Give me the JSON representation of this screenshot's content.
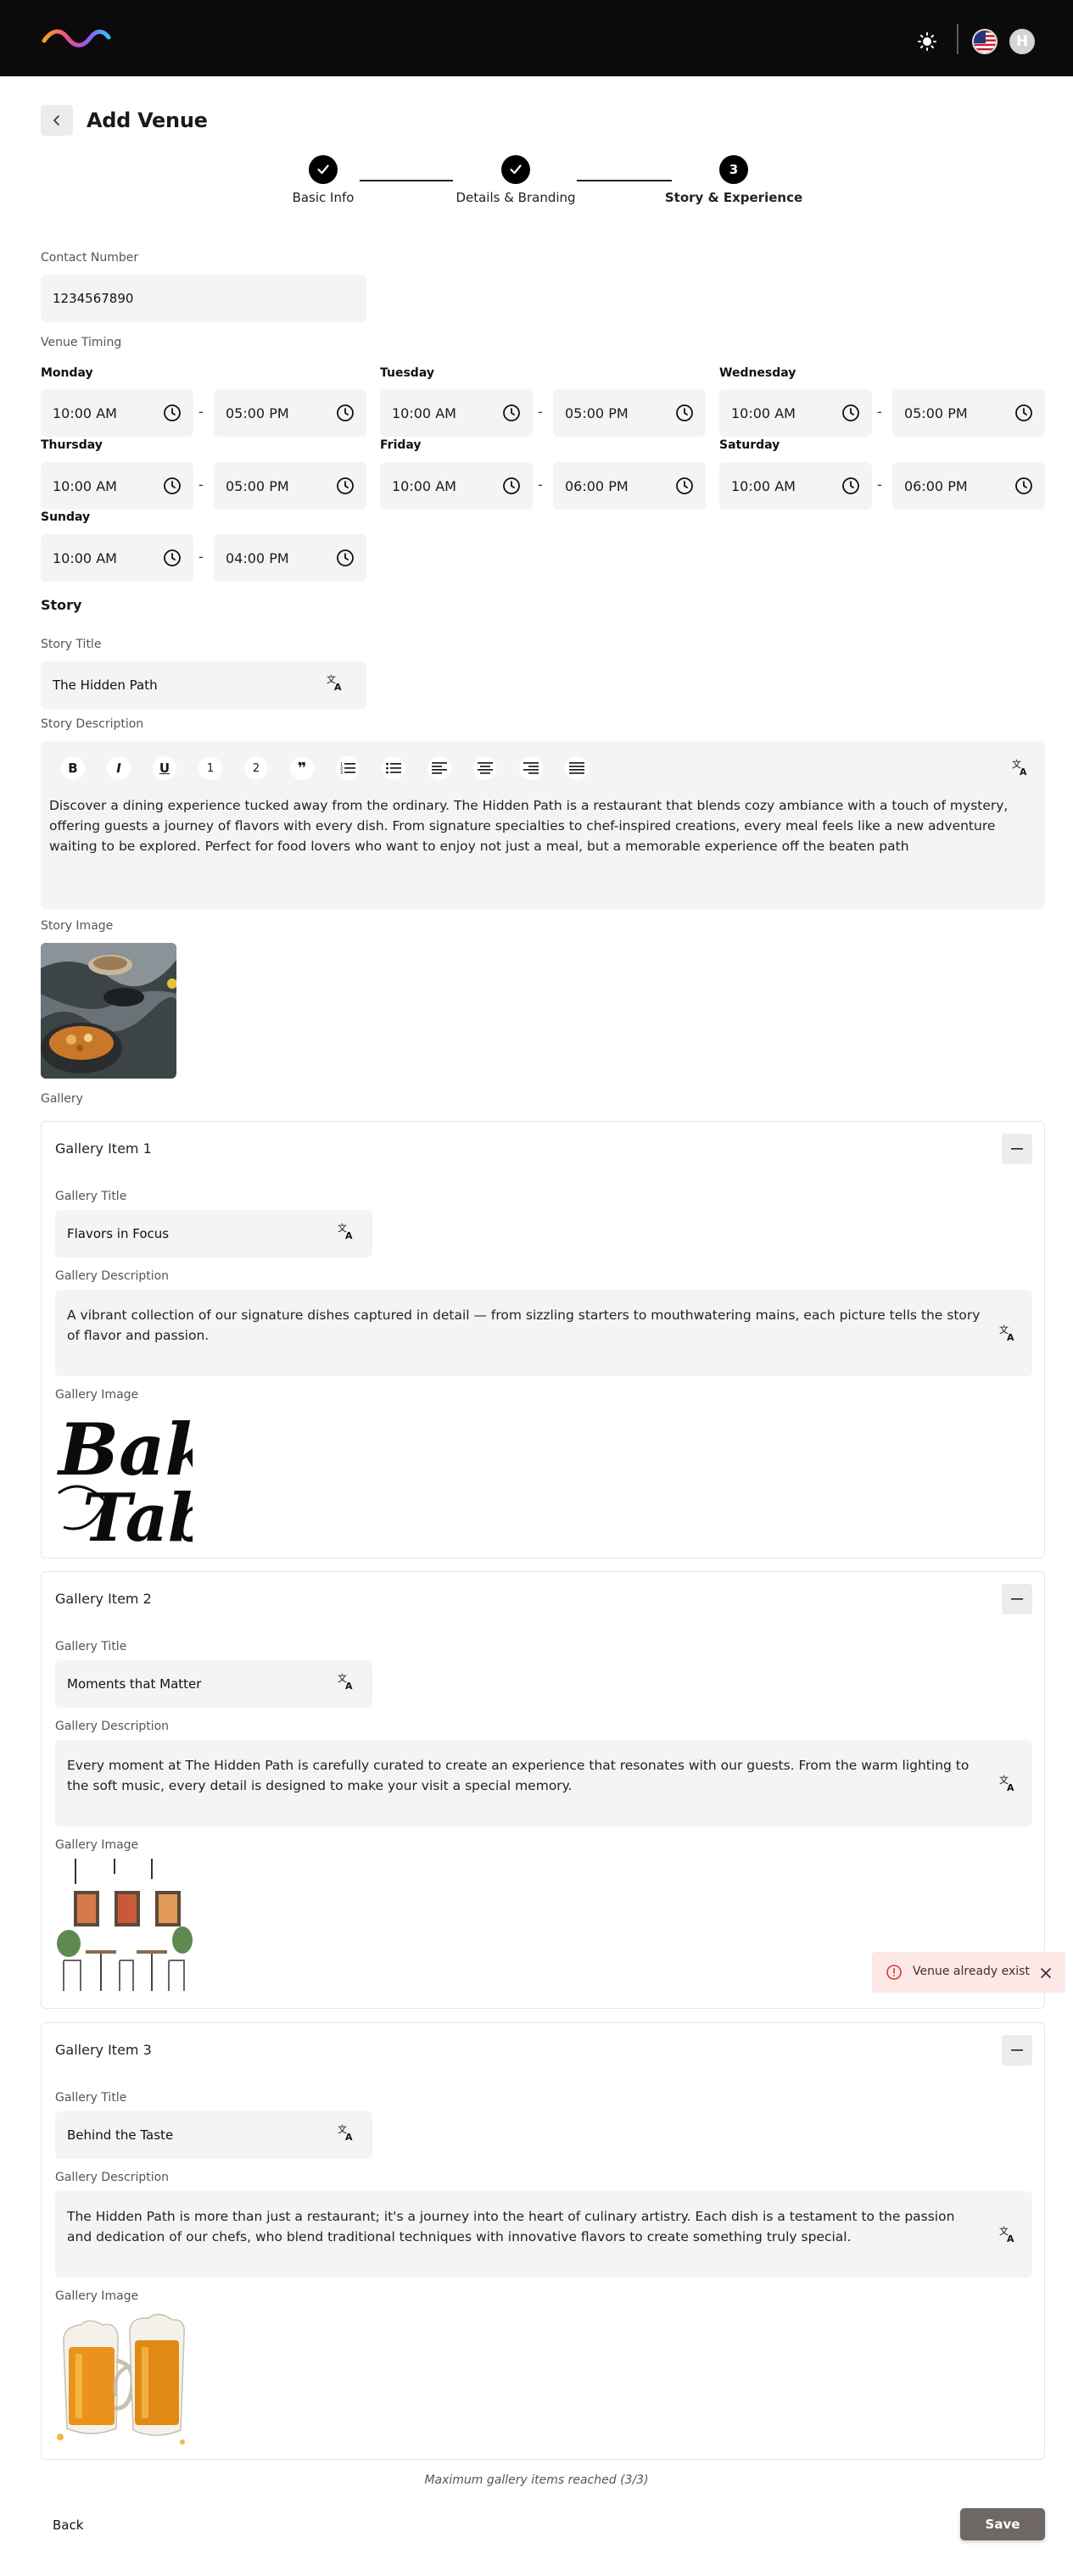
{
  "header": {
    "page_title": "Add Venue"
  },
  "stepper": {
    "steps": [
      {
        "label": "Basic Info",
        "status": "done"
      },
      {
        "label": "Details & Branding",
        "status": "done"
      },
      {
        "label": "Story & Experience",
        "number": "3",
        "status": "active"
      }
    ]
  },
  "contact": {
    "label": "Contact Number",
    "value": "1234567890"
  },
  "timing": {
    "label": "Venue Timing",
    "days": [
      {
        "day": "Monday",
        "open": "10:00 AM",
        "close": "05:00 PM"
      },
      {
        "day": "Tuesday",
        "open": "10:00 AM",
        "close": "05:00 PM"
      },
      {
        "day": "Wednesday",
        "open": "10:00 AM",
        "close": "05:00 PM"
      },
      {
        "day": "Thursday",
        "open": "10:00 AM",
        "close": "05:00 PM"
      },
      {
        "day": "Friday",
        "open": "10:00 AM",
        "close": "06:00 PM"
      },
      {
        "day": "Saturday",
        "open": "10:00 AM",
        "close": "06:00 PM"
      },
      {
        "day": "Sunday",
        "open": "10:00 AM",
        "close": "04:00 PM"
      }
    ],
    "separator": "-"
  },
  "story": {
    "heading": "Story",
    "title_label": "Story Title",
    "title_value": "The Hidden Path",
    "description_label": "Story Description",
    "toolbar": {
      "bold": "B",
      "italic": "I",
      "underline": "U",
      "h1": "1",
      "h2": "2",
      "quote": "❞"
    },
    "description_value": "Discover a dining experience tucked away from the ordinary. The Hidden Path is a restaurant that blends cozy ambiance with a touch of mystery, offering guests a journey of flavors with every dish. From signature specialties to chef-inspired creations, every meal feels like a new adventure waiting to be explored. Perfect for food lovers who want to enjoy not just a meal, but a memorable experience off the beaten path",
    "image_label": "Story Image"
  },
  "gallery": {
    "label": "Gallery",
    "field_labels": {
      "title": "Gallery Title",
      "description": "Gallery Description",
      "image": "Gallery Image"
    },
    "items": [
      {
        "heading": "Gallery Item 1",
        "title": "Flavors in Focus",
        "description": "A vibrant collection of our signature dishes captured in detail — from sizzling starters to mouthwatering mains, each picture tells the story of flavor and passion.",
        "image_text": "Bakes Table"
      },
      {
        "heading": "Gallery Item 2",
        "title": "Moments that Matter",
        "description": "Every moment at The Hidden Path is carefully curated to create an experience that resonates with our guests. From the warm lighting to the soft music, every detail is designed to make your visit a special memory."
      },
      {
        "heading": "Gallery Item 3",
        "title": "Behind the Taste",
        "description": "The Hidden Path is more than just a restaurant; it's a journey into the heart of culinary artistry. Each dish is a testament to the passion and dedication of our chefs, who blend traditional techniques with innovative flavors to create something truly special."
      }
    ],
    "max_note": "Maximum gallery items reached (3/3)"
  },
  "footer": {
    "back_label": "Back",
    "save_label": "Save"
  },
  "toast": {
    "message": "Venue already exist"
  },
  "avatar_initial": "H",
  "colors": {
    "topbar": "#0b0b0b",
    "field_bg": "#f4f4f4",
    "save_button": "#6e6763",
    "toast_bg": "#fde8e8"
  }
}
